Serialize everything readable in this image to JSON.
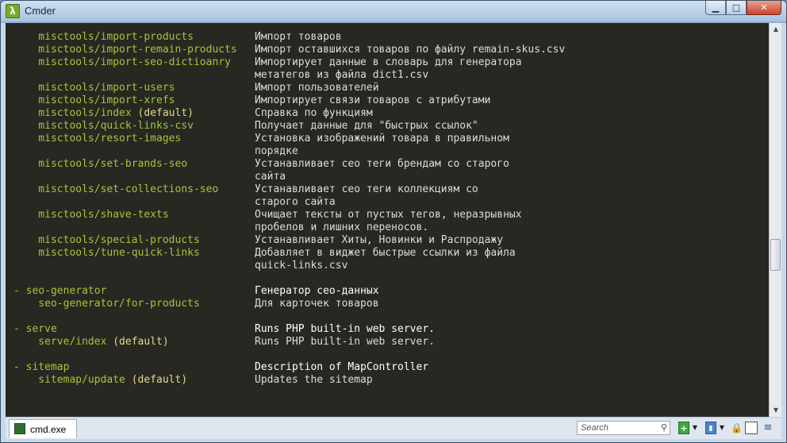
{
  "window": {
    "title": "Cmder"
  },
  "console": {
    "lines": [
      {
        "cmd": "    misctools/import-products",
        "default": "",
        "desc": "Импорт товаров",
        "group": false
      },
      {
        "cmd": "    misctools/import-remain-products",
        "default": "",
        "desc": "Импорт оставшихся товаров по файлу remain-skus.csv",
        "group": false
      },
      {
        "cmd": "    misctools/import-seo-dictioanry",
        "default": "",
        "desc": "Импортирует данные в словарь для генератора",
        "group": false
      },
      {
        "cmd": "",
        "default": "",
        "desc": "метатегов из файла dict1.csv",
        "group": false
      },
      {
        "cmd": "    misctools/import-users",
        "default": "",
        "desc": "Импорт пользователей",
        "group": false
      },
      {
        "cmd": "    misctools/import-xrefs",
        "default": "",
        "desc": "Импортирует связи товаров с атрибутами",
        "group": false
      },
      {
        "cmd": "    misctools/index",
        "default": " (default)",
        "desc": "Справка по функциям",
        "group": false
      },
      {
        "cmd": "    misctools/quick-links-csv",
        "default": "",
        "desc": "Получает данные для \"быстрых ссылок\"",
        "group": false
      },
      {
        "cmd": "    misctools/resort-images",
        "default": "",
        "desc": "Установка изображений товара в правильном",
        "group": false
      },
      {
        "cmd": "",
        "default": "",
        "desc": "порядке",
        "group": false
      },
      {
        "cmd": "    misctools/set-brands-seo",
        "default": "",
        "desc": "Устанавливает сео теги брендам со старого",
        "group": false
      },
      {
        "cmd": "",
        "default": "",
        "desc": "сайта",
        "group": false
      },
      {
        "cmd": "    misctools/set-collections-seo",
        "default": "",
        "desc": "Устанавливает сео теги коллекциям со",
        "group": false
      },
      {
        "cmd": "",
        "default": "",
        "desc": "старого сайта",
        "group": false
      },
      {
        "cmd": "    misctools/shave-texts",
        "default": "",
        "desc": "Очищает тексты от пустых тегов, неразрывных",
        "group": false
      },
      {
        "cmd": "",
        "default": "",
        "desc": "пробелов и лишних переносов.",
        "group": false
      },
      {
        "cmd": "    misctools/special-products",
        "default": "",
        "desc": "Устанавливает Хиты, Новинки и Распродажу",
        "group": false
      },
      {
        "cmd": "    misctools/tune-quick-links",
        "default": "",
        "desc": "Добавляет в виджет быстрые ссылки из файла",
        "group": false
      },
      {
        "cmd": "",
        "default": "",
        "desc": "quick-links.csv",
        "group": false
      },
      {
        "cmd": "",
        "default": "",
        "desc": "",
        "group": false
      },
      {
        "cmd": "- seo-generator",
        "default": "",
        "desc": "Генератор сео-данных",
        "group": true
      },
      {
        "cmd": "    seo-generator/for-products",
        "default": "",
        "desc": "Для карточек товаров",
        "group": false
      },
      {
        "cmd": "",
        "default": "",
        "desc": "",
        "group": false
      },
      {
        "cmd": "- serve",
        "default": "",
        "desc": "Runs PHP built-in web server.",
        "group": true
      },
      {
        "cmd": "    serve/index",
        "default": " (default)",
        "desc": "Runs PHP built-in web server.",
        "group": false
      },
      {
        "cmd": "",
        "default": "",
        "desc": "",
        "group": false
      },
      {
        "cmd": "- sitemap",
        "default": "",
        "desc": "Description of MapController",
        "group": true
      },
      {
        "cmd": "    sitemap/update",
        "default": " (default)",
        "desc": "Updates the sitemap",
        "group": false
      }
    ]
  },
  "statusbar": {
    "tab_label": "cmd.exe",
    "search_placeholder": "Search"
  },
  "icons": {
    "app": "lambda-icon",
    "search": "magnifier-icon",
    "add": "plus-icon",
    "lock": "lock-icon",
    "menu": "hamburger-icon"
  },
  "colors": {
    "console_bg": "#272822",
    "command": "#a6c43a",
    "default_tag": "#e6d98a",
    "text": "#dcdcdc"
  }
}
